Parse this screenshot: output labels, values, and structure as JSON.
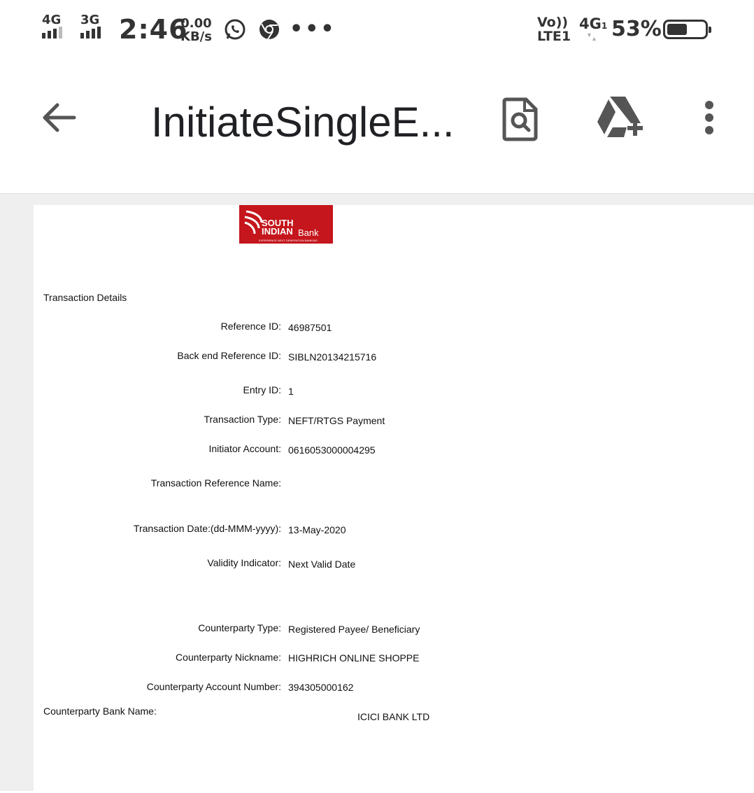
{
  "status_bar": {
    "sim1_network": "4G",
    "sim2_network": "3G",
    "time": "2:46",
    "net_speed_value": "0.00",
    "net_speed_unit": "KB/s",
    "overflow_dots": "•••",
    "volte_line1": "Vo))",
    "volte_line2": "LTE1",
    "data_network": "4G",
    "data_network_sub": "1",
    "battery_percent": "53%",
    "battery_level": 0.53
  },
  "app_bar": {
    "title": "InitiateSingleE..."
  },
  "logo": {
    "line1": "SOUTH",
    "line2": "INDIAN",
    "bank": "Bank",
    "tagline": "EXPERIENCE NEXT GENERATION BANKING"
  },
  "document": {
    "section_title": "Transaction Details",
    "fields": [
      {
        "label": "Reference ID:",
        "value": "46987501"
      },
      {
        "label": "Back end Reference ID:",
        "value": "SIBLN20134215716"
      },
      {
        "label": "Entry ID:",
        "value": "1"
      },
      {
        "label": "Transaction Type:",
        "value": "NEFT/RTGS Payment"
      },
      {
        "label": "Initiator Account:",
        "value": "0616053000004295"
      },
      {
        "label": "Transaction Reference Name:",
        "value": ""
      },
      {
        "label": "Transaction Date:(dd-MMM-yyyy):",
        "value": "13-May-2020"
      },
      {
        "label": "Validity Indicator:",
        "value": "Next Valid Date"
      },
      {
        "label": "Counterparty Type:",
        "value": "Registered Payee/ Beneficiary"
      },
      {
        "label": "Counterparty Nickname:",
        "value": "HIGHRICH ONLINE SHOPPE"
      },
      {
        "label": "Counterparty Account Number:",
        "value": "394305000162"
      }
    ],
    "bank_name_label": "Counterparty Bank Name:",
    "bank_name_value": "ICICI BANK LTD"
  }
}
